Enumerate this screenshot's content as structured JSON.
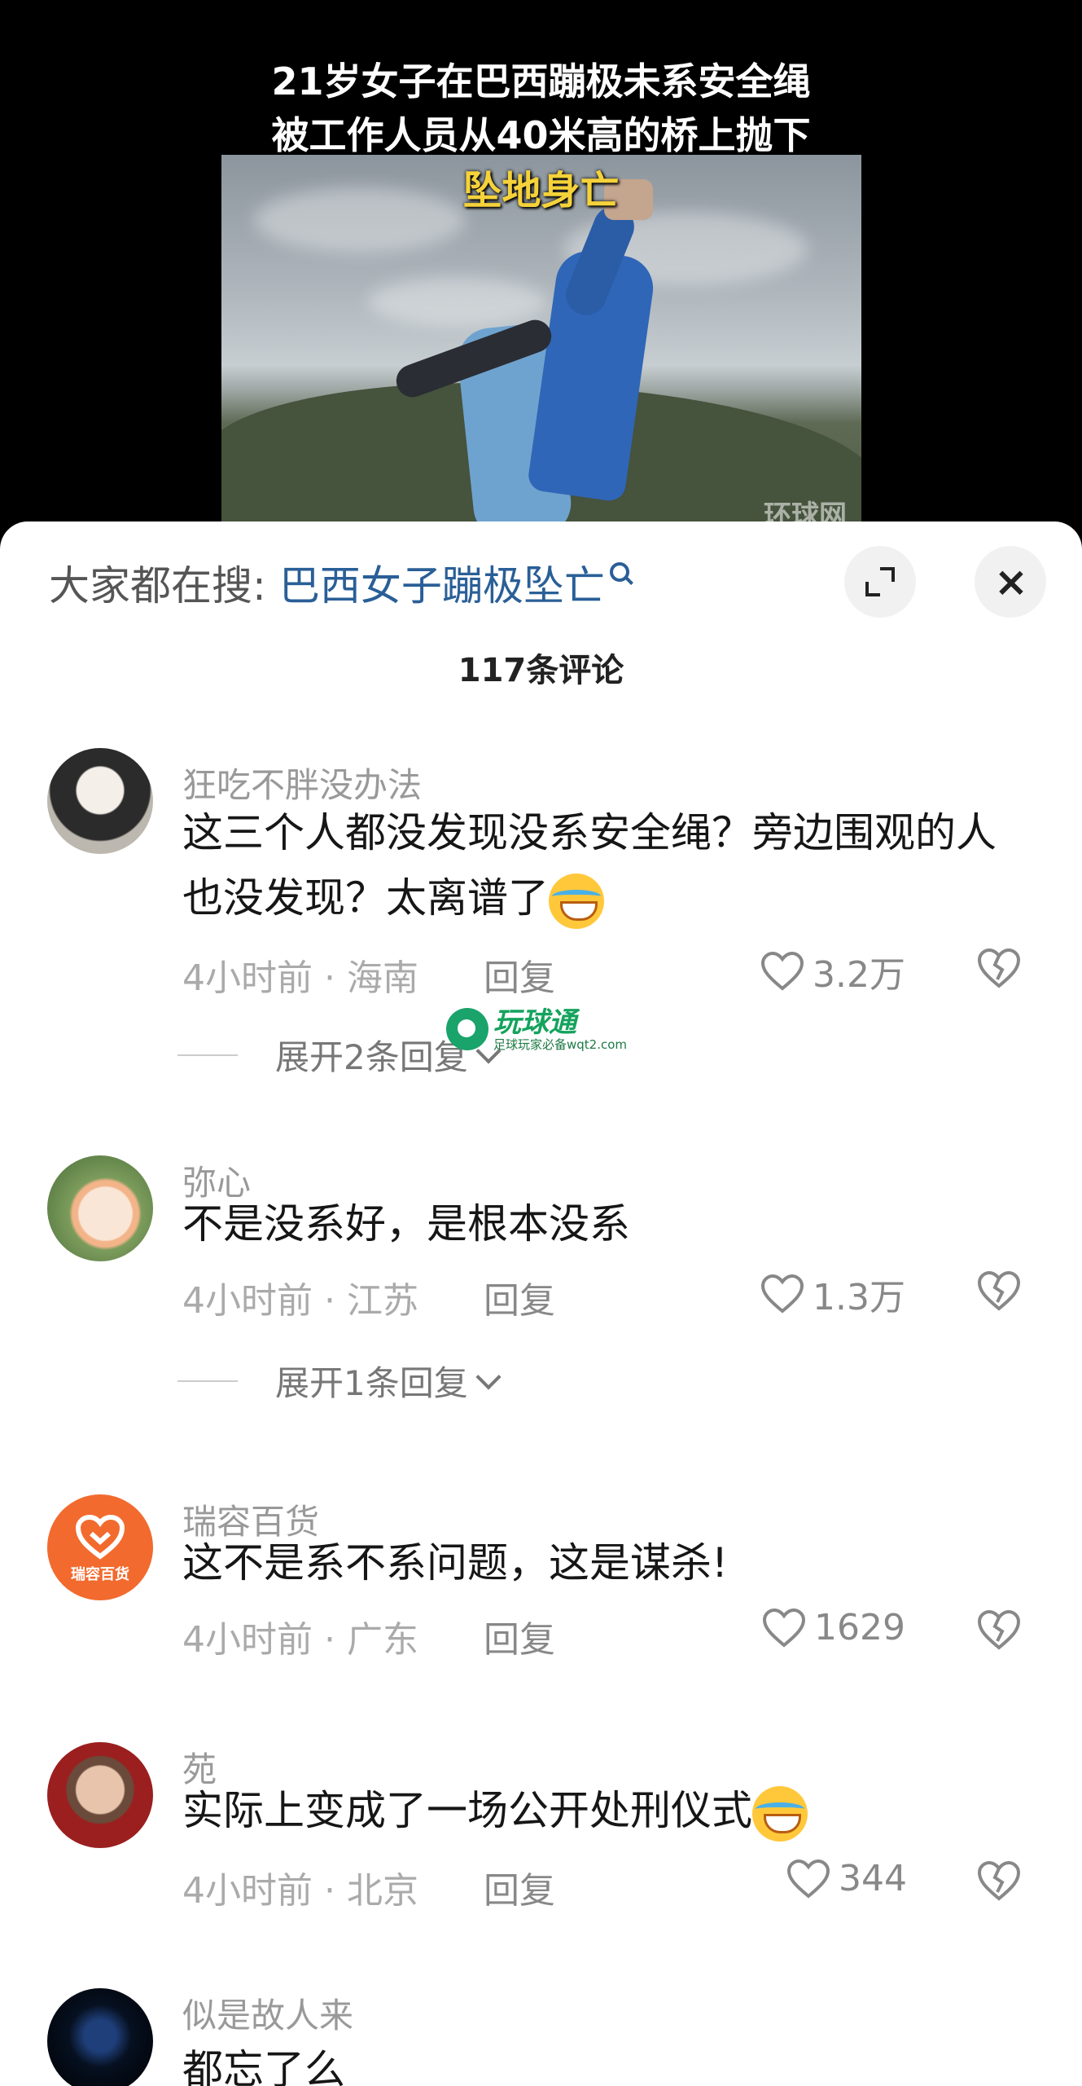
{
  "video": {
    "title_line1": "21岁女子在巴西蹦极未系安全绳",
    "title_line2": "被工作人员从40米高的桥上抛下",
    "caption": "坠地身亡",
    "watermark": "环球网"
  },
  "sheet": {
    "search_prefix": "大家都在搜:",
    "search_term": "巴西女子蹦极坠亡",
    "comment_count": "117条评论",
    "icons": {
      "expand": "expand-icon",
      "close": "close-icon",
      "search": "search-icon"
    }
  },
  "promo": {
    "name": "玩球通",
    "tagline": "足球玩家必备wqt2.com"
  },
  "comments": [
    {
      "user": "狂吃不胖没办法",
      "text": "这三个人都没发现没系安全绳？旁边围观的人也没发现？太离谱了",
      "time": "4小时前 · 海南",
      "reply": "回复",
      "likes": "3.2万",
      "expand": "展开2条回复"
    },
    {
      "user": "弥心",
      "text": "不是没系好，是根本没系",
      "time": "4小时前 · 江苏",
      "reply": "回复",
      "likes": "1.3万",
      "expand": "展开1条回复"
    },
    {
      "user": "瑞容百货",
      "avatar_text": "瑞容百货",
      "text": "这不是系不系问题，这是谋杀!",
      "time": "4小时前 · 广东",
      "reply": "回复",
      "likes": "1629"
    },
    {
      "user": "苑",
      "text": "实际上变成了一场公开处刑仪式",
      "time": "4小时前 · 北京",
      "reply": "回复",
      "likes": "344"
    },
    {
      "user": "似是故人来",
      "text": "都忘了么"
    }
  ]
}
